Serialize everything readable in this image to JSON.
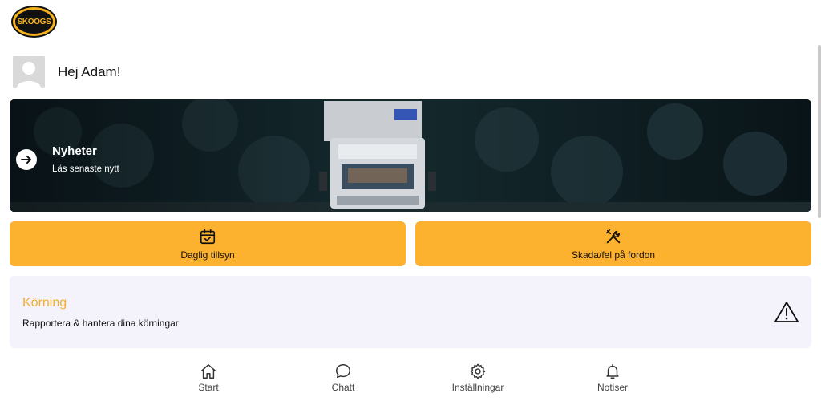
{
  "brand": {
    "logo_text": "SKOOGS",
    "accent": "#fdb22f"
  },
  "user": {
    "greeting": "Hej Adam!"
  },
  "news": {
    "title": "Nyheter",
    "subtitle": "Läs senaste nytt",
    "icon": "arrow-right-icon"
  },
  "actions": [
    {
      "label": "Daglig tillsyn",
      "icon": "calendar-check-icon"
    },
    {
      "label": "Skada/fel på fordon",
      "icon": "tools-icon"
    }
  ],
  "korning": {
    "title": "Körning",
    "subtitle": "Rapportera & hantera dina körningar",
    "icon": "warning-icon",
    "title_color": "#f5ae2b"
  },
  "nav": [
    {
      "label": "Start",
      "icon": "home-icon"
    },
    {
      "label": "Chatt",
      "icon": "chat-icon"
    },
    {
      "label": "Inställningar",
      "icon": "gear-icon"
    },
    {
      "label": "Notiser",
      "icon": "bell-icon"
    }
  ]
}
